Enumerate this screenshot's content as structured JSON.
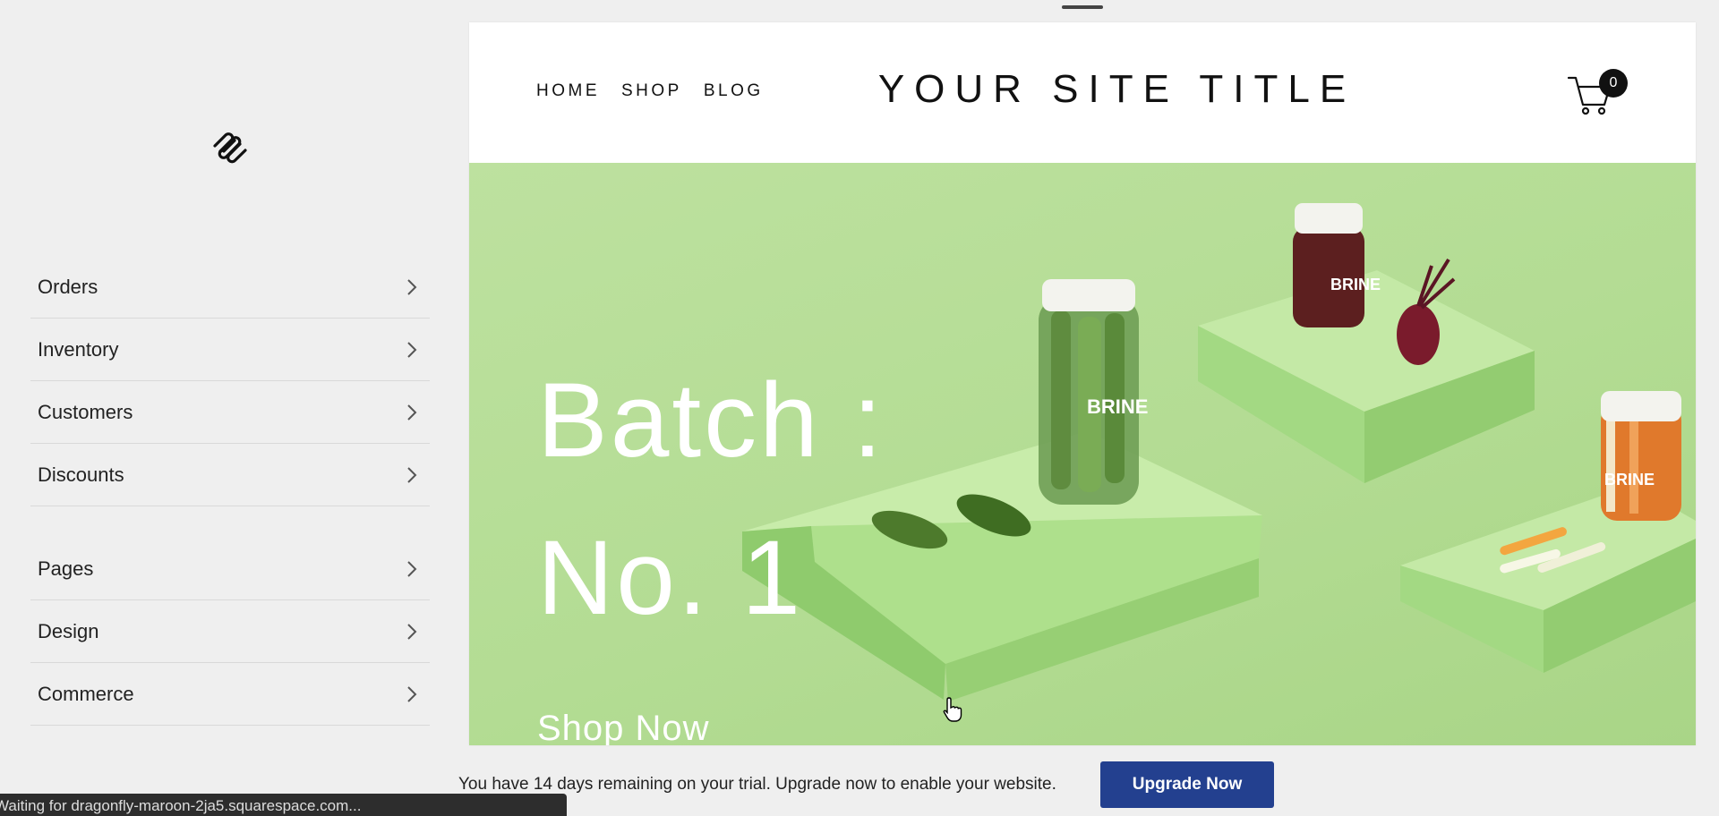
{
  "sidebar": {
    "logo_icon": "squarespace-logo-icon",
    "groups": [
      {
        "items": [
          {
            "label": "Orders"
          },
          {
            "label": "Inventory"
          },
          {
            "label": "Customers"
          },
          {
            "label": "Discounts"
          }
        ]
      },
      {
        "items": [
          {
            "label": "Pages"
          },
          {
            "label": "Design"
          },
          {
            "label": "Commerce"
          }
        ]
      }
    ],
    "chevron_icon": "chevron-right-icon"
  },
  "site": {
    "nav": [
      "HOME",
      "SHOP",
      "BLOG"
    ],
    "title": "YOUR SITE TITLE",
    "cart_icon": "cart-icon",
    "cart_count": "0",
    "hero": {
      "heading_line1": "Batch :",
      "heading_line2": "No. 1",
      "cta": "Shop Now",
      "jar_label": "BRINE",
      "background_color": "#b6de96"
    }
  },
  "trial": {
    "message": "You have 14 days remaining on your trial. Upgrade now to enable your website.",
    "button_label": "Upgrade Now",
    "button_color": "#23408f"
  },
  "status_bar": {
    "text": "Waiting for dragonfly-maroon-2ja5.squarespace.com..."
  }
}
